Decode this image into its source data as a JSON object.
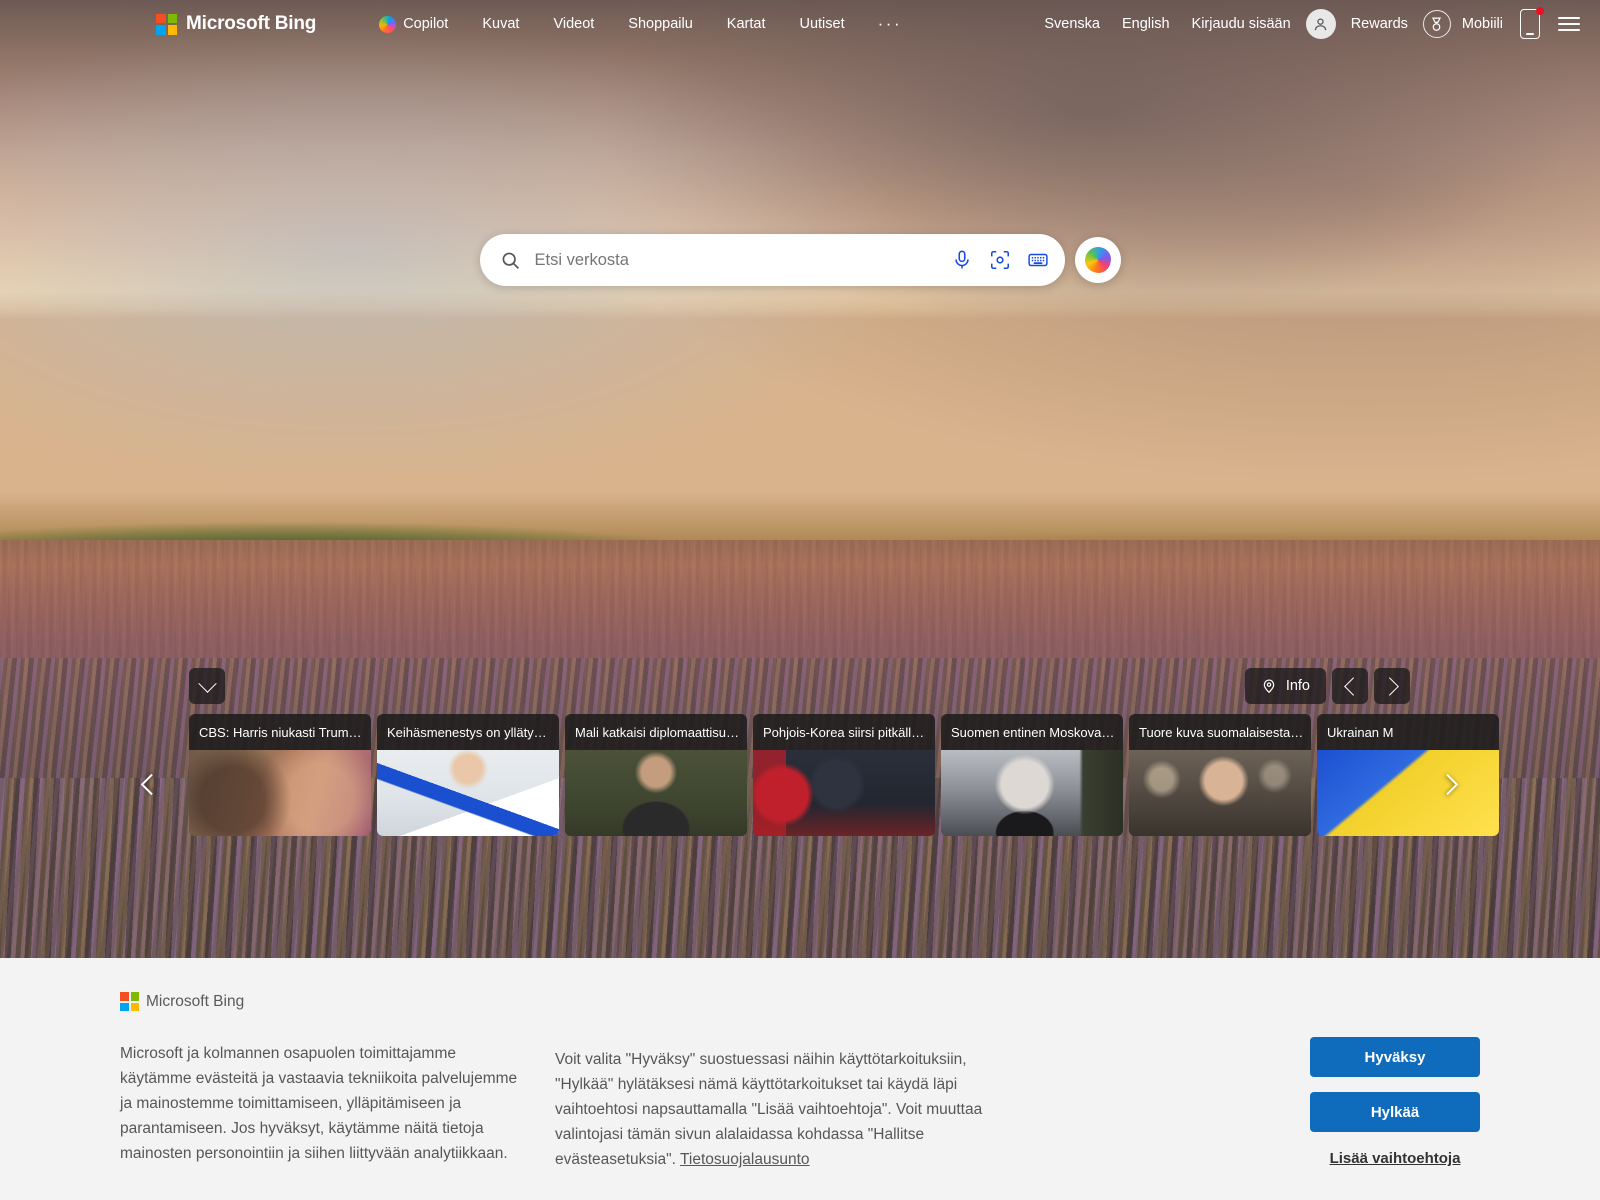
{
  "header": {
    "brand": "Microsoft Bing",
    "nav": [
      {
        "label": "Copilot",
        "icon": "copilot-icon"
      },
      {
        "label": "Kuvat",
        "icon": ""
      },
      {
        "label": "Videot",
        "icon": ""
      },
      {
        "label": "Shoppailu",
        "icon": ""
      },
      {
        "label": "Kartat",
        "icon": ""
      },
      {
        "label": "Uutiset",
        "icon": ""
      }
    ],
    "overflow": "···",
    "lang_sv": "Svenska",
    "lang_en": "English",
    "sign_in": "Kirjaudu sisään",
    "rewards": "Rewards",
    "mobile": "Mobiili",
    "avatar_icon": "person-icon",
    "rewards_icon": "medal-icon",
    "mobile_icon": "phone-icon",
    "menu_icon": "hamburger-icon"
  },
  "search": {
    "placeholder": "Etsi verkosta",
    "value": "",
    "search_icon": "search-icon",
    "mic_icon": "microphone-icon",
    "lens_icon": "visual-search-icon",
    "keyboard_icon": "keyboard-icon",
    "copilot_icon": "copilot-orb-icon"
  },
  "hero": {
    "collapse_icon": "chevron-down-icon",
    "info_label": "Info",
    "info_icon": "location-pin-icon",
    "prev_icon": "chevron-left-icon",
    "next_icon": "chevron-right-icon",
    "carousel_prev_icon": "chevron-left-icon",
    "carousel_next_icon": "chevron-right-icon"
  },
  "news": [
    {
      "title": "CBS: Harris niukasti Trum…",
      "thumb": "th1"
    },
    {
      "title": "Keihäsmenestys on ylläty…",
      "thumb": "th2"
    },
    {
      "title": "Mali katkaisi diplomaattisu…",
      "thumb": "th3"
    },
    {
      "title": "Pohjois-Korea siirsi pitkäll…",
      "thumb": "th4"
    },
    {
      "title": "Suomen entinen Moskova…",
      "thumb": "th5"
    },
    {
      "title": "Tuore kuva suomalaisesta…",
      "thumb": "th6"
    },
    {
      "title": "Ukrainan M",
      "thumb": "th7"
    }
  ],
  "cookie": {
    "brand": "Microsoft Bing",
    "paragraph_left": "Microsoft ja kolmannen osapuolen toimittajamme käytämme evästeitä ja vastaavia tekniikoita palvelujemme ja mainostemme toimittamiseen, ylläpitämiseen ja parantamiseen. Jos hyväksyt, käytämme näitä tietoja mainosten personointiin ja siihen liittyvään analytiikkaan.",
    "paragraph_right": "Voit valita \"Hyväksy\" suostuessasi näihin käyttötarkoituksiin, \"Hylkää\" hylätäksesi nämä käyttötarkoitukset tai käydä läpi vaihtoehtosi napsauttamalla \"Lisää vaihtoehtoja\". Voit muuttaa valintojasi tämän sivun alalaidassa kohdassa \"Hallitse evästeasetuksia\".  ",
    "privacy_link": "Tietosuojalausunto",
    "accept": "Hyväksy",
    "reject": "Hylkää",
    "more_options": "Lisää vaihtoehtoja"
  },
  "colors": {
    "accent": "#0f6cbd",
    "search_icon_blue": "#174ae4",
    "badge_red": "#e81123",
    "ms_red": "#f25022",
    "ms_green": "#7fba00",
    "ms_blue": "#00a4ef",
    "ms_yellow": "#ffb900"
  }
}
